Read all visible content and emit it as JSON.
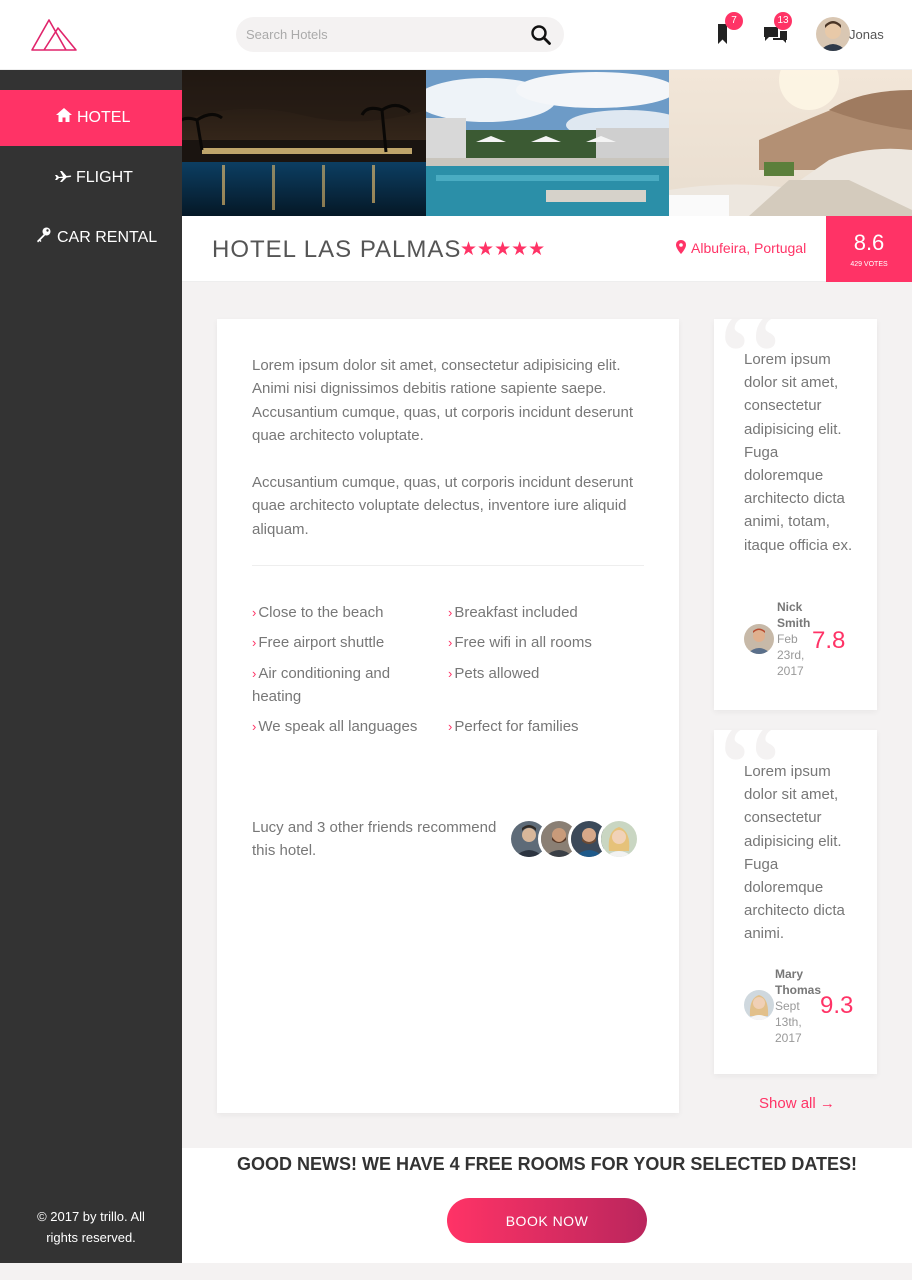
{
  "header": {
    "logo_icon": "trillo-logo-icon",
    "search": {
      "placeholder": "Search Hotels"
    },
    "bookmarks": {
      "count": "7",
      "icon": "bookmark-icon"
    },
    "messages": {
      "count": "13",
      "icon": "chat-icon"
    },
    "user": {
      "name": "Jonas"
    }
  },
  "sidebar": {
    "items": [
      {
        "label": "Hotel",
        "icon": "home-icon",
        "active": true
      },
      {
        "label": "Flight",
        "icon": "airplane-icon",
        "active": false
      },
      {
        "label": "Car Rental",
        "icon": "key-icon",
        "active": false
      }
    ],
    "copyright": "© 2017 by trillo. All rights reserved."
  },
  "hotel": {
    "name": "Hotel Las Palmas",
    "stars": "★★★★★",
    "location": "Albufeira, Portugal",
    "rating": "8.6",
    "votes": "429 votes"
  },
  "description": {
    "paragraphs": [
      "Lorem ipsum dolor sit amet, consectetur adipisicing elit. Animi nisi dignissimos debitis ratione sapiente saepe. Accusantium cumque, quas, ut corporis incidunt deserunt quae architecto voluptate.",
      "Accusantium cumque, quas, ut corporis incidunt deserunt quae architecto voluptate delectus, inventore iure aliquid aliquam."
    ],
    "features": [
      "Close to the beach",
      "Breakfast included",
      "Free airport shuttle",
      "Free wifi in all rooms",
      "Air conditioning and heating",
      "Pets allowed",
      "We speak all languages",
      "Perfect for families"
    ],
    "recommend": "Lucy and 3 other friends recommend this hotel."
  },
  "reviews": [
    {
      "text": "Lorem ipsum dolor sit amet, consectetur adipisicing elit. Fuga doloremque architecto dicta animi, totam, itaque officia ex.",
      "name": "Nick Smith",
      "date": "Feb 23rd, 2017",
      "score": "7.8"
    },
    {
      "text": "Lorem ipsum dolor sit amet, consectetur adipisicing elit. Fuga doloremque architecto dicta animi.",
      "name": "Mary Thomas",
      "date": "Sept 13th, 2017",
      "score": "9.3"
    }
  ],
  "show_all": "Show all →",
  "cta": {
    "text": "Good news! We have 4 free rooms for your selected dates!",
    "button": "Book now"
  },
  "colors": {
    "accent": "#ff3366",
    "sidebar": "#333333",
    "background": "#f4f2f2"
  }
}
